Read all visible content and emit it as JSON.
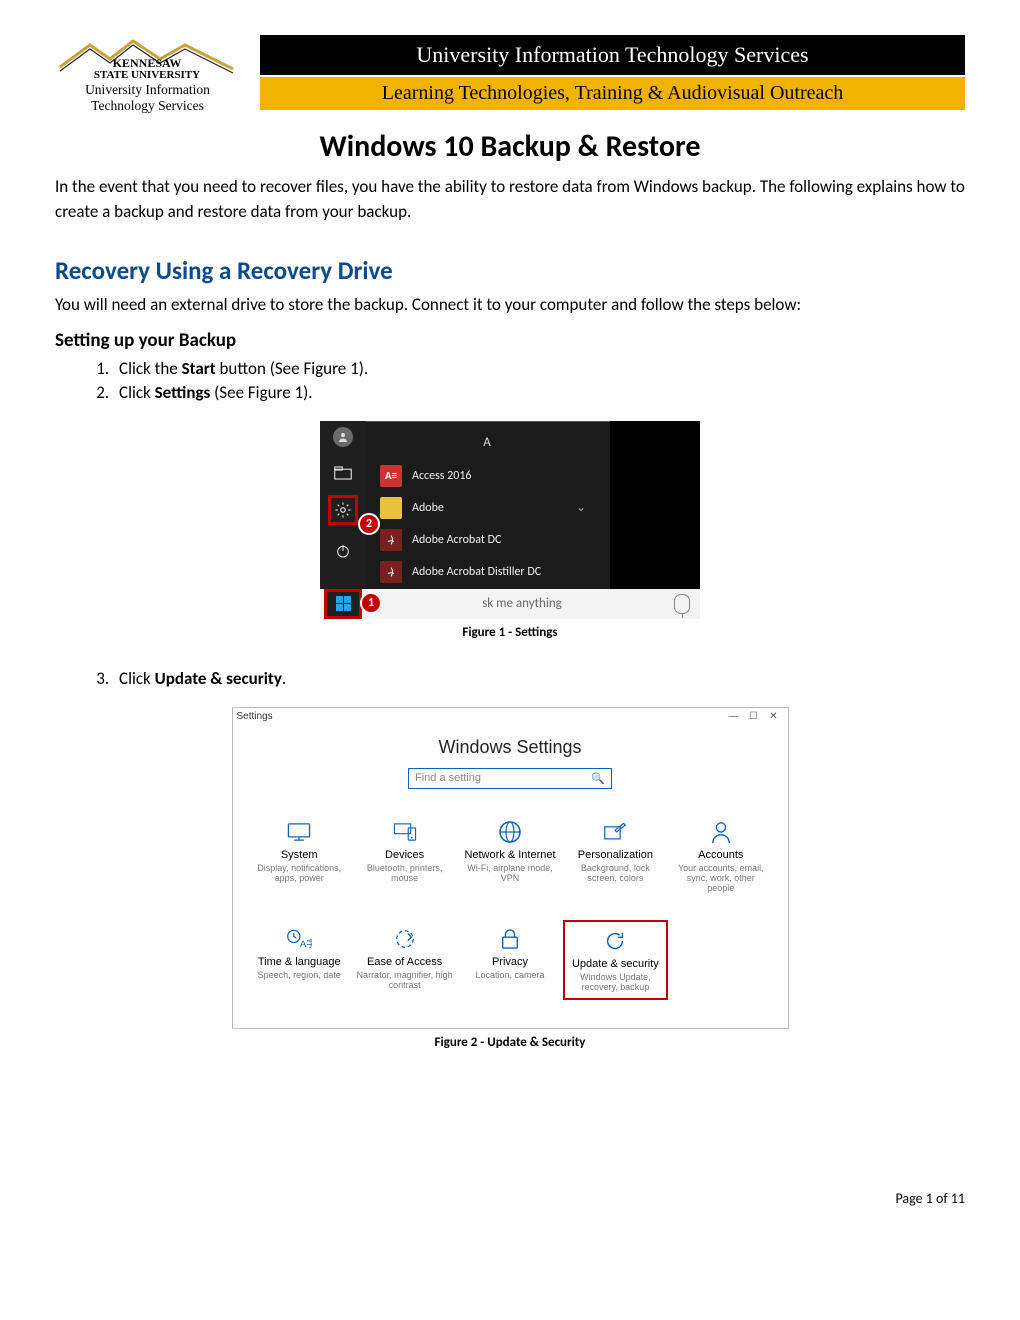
{
  "logo": {
    "line1": "KENNESAW",
    "line2": "STATE UNIVERSITY",
    "sub1": "University Information",
    "sub2": "Technology Services"
  },
  "banners": {
    "black": "University Information Technology Services",
    "gold": "Learning Technologies, Training & Audiovisual Outreach"
  },
  "doc_title": "Windows 10 Backup & Restore",
  "intro": "In the event that you need to recover files, you have the ability to restore data from Windows backup. The following explains how to create a backup and restore data from your backup.",
  "section1": {
    "heading": "Recovery Using a Recovery Drive",
    "desc": "You will need an external drive to store the backup. Connect it to your computer and follow the steps below:",
    "sub_heading": "Setting up your Backup",
    "steps12": [
      {
        "prefix": "Click the ",
        "bold": "Start",
        "suffix": " button (See Figure 1)."
      },
      {
        "prefix": "Click ",
        "bold": "Settings",
        "suffix": " (See Figure 1)."
      }
    ],
    "step3": {
      "prefix": "Click ",
      "bold": "Update & security",
      "suffix": "."
    }
  },
  "figure1": {
    "caption": "Figure 1 - Settings",
    "letter": "A",
    "apps": [
      "Access 2016",
      "Adobe",
      "Adobe Acrobat DC",
      "Adobe Acrobat Distiller DC"
    ],
    "search_placeholder": "sk me anything",
    "callout1": "1",
    "callout2": "2"
  },
  "figure2": {
    "caption": "Figure 2 - Update & Security",
    "window_title": "Settings",
    "heading": "Windows Settings",
    "search_placeholder": "Find a setting",
    "tiles_row1": [
      {
        "title": "System",
        "sub": "Display, notifications, apps, power"
      },
      {
        "title": "Devices",
        "sub": "Bluetooth, printers, mouse"
      },
      {
        "title": "Network & Internet",
        "sub": "Wi-Fi, airplane mode, VPN"
      },
      {
        "title": "Personalization",
        "sub": "Background, lock screen, colors"
      },
      {
        "title": "Accounts",
        "sub": "Your accounts, email, sync, work, other people"
      }
    ],
    "tiles_row2": [
      {
        "title": "Time & language",
        "sub": "Speech, region, date"
      },
      {
        "title": "Ease of Access",
        "sub": "Narrator, magnifier, high contrast"
      },
      {
        "title": "Privacy",
        "sub": "Location, camera"
      },
      {
        "title": "Update & security",
        "sub": "Windows Update, recovery, backup",
        "highlight": true
      }
    ]
  },
  "page_footer": "Page 1 of 11"
}
